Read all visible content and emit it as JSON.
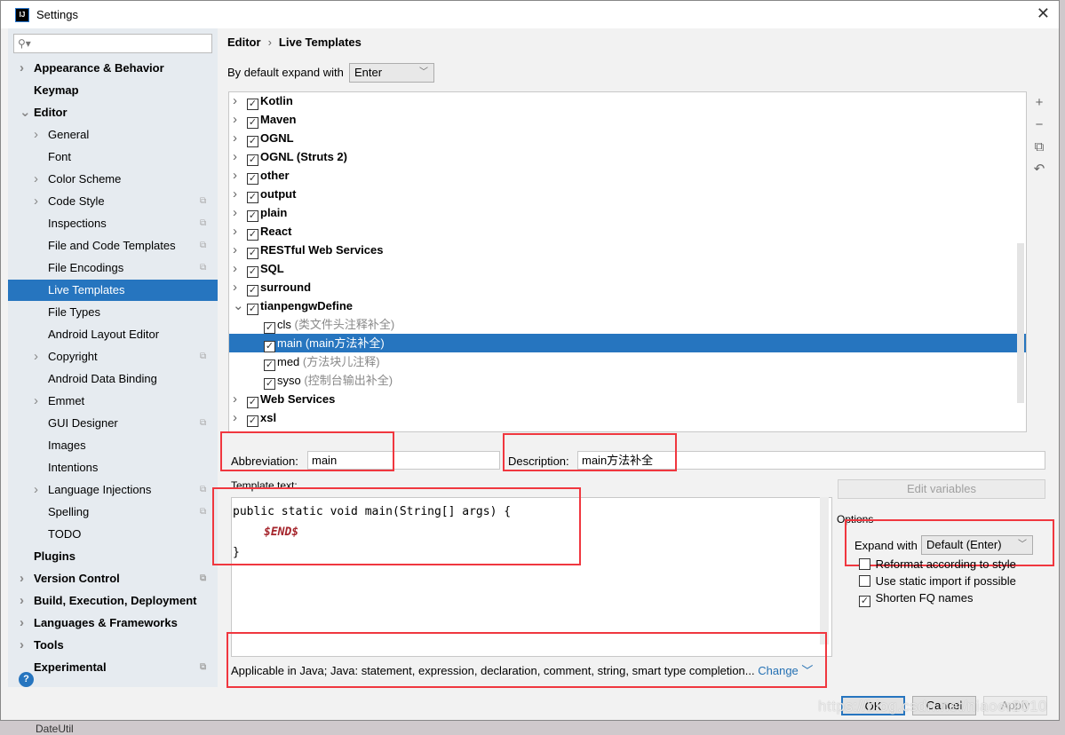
{
  "window": {
    "title": "Settings",
    "close": "✕"
  },
  "sidebar": {
    "search_placeholder": "",
    "items": [
      {
        "label": "Appearance & Behavior",
        "level": 0,
        "bold": true,
        "arrow": "right"
      },
      {
        "label": "Keymap",
        "level": 0,
        "bold": true
      },
      {
        "label": "Editor",
        "level": 0,
        "bold": true,
        "arrow": "down"
      },
      {
        "label": "General",
        "level": 1,
        "arrow": "right"
      },
      {
        "label": "Font",
        "level": 1
      },
      {
        "label": "Color Scheme",
        "level": 1,
        "arrow": "right"
      },
      {
        "label": "Code Style",
        "level": 1,
        "arrow": "right",
        "copy": true
      },
      {
        "label": "Inspections",
        "level": 1,
        "copy": true
      },
      {
        "label": "File and Code Templates",
        "level": 1,
        "copy": true
      },
      {
        "label": "File Encodings",
        "level": 1,
        "copy": true
      },
      {
        "label": "Live Templates",
        "level": 1,
        "selected": true
      },
      {
        "label": "File Types",
        "level": 1
      },
      {
        "label": "Android Layout Editor",
        "level": 1
      },
      {
        "label": "Copyright",
        "level": 1,
        "arrow": "right",
        "copy": true
      },
      {
        "label": "Android Data Binding",
        "level": 1
      },
      {
        "label": "Emmet",
        "level": 1,
        "arrow": "right"
      },
      {
        "label": "GUI Designer",
        "level": 1,
        "copy": true
      },
      {
        "label": "Images",
        "level": 1
      },
      {
        "label": "Intentions",
        "level": 1
      },
      {
        "label": "Language Injections",
        "level": 1,
        "arrow": "right",
        "copy": true
      },
      {
        "label": "Spelling",
        "level": 1,
        "copy": true
      },
      {
        "label": "TODO",
        "level": 1
      },
      {
        "label": "Plugins",
        "level": 0,
        "bold": true
      },
      {
        "label": "Version Control",
        "level": 0,
        "bold": true,
        "arrow": "right",
        "copy": true
      },
      {
        "label": "Build, Execution, Deployment",
        "level": 0,
        "bold": true,
        "arrow": "right"
      },
      {
        "label": "Languages & Frameworks",
        "level": 0,
        "bold": true,
        "arrow": "right"
      },
      {
        "label": "Tools",
        "level": 0,
        "bold": true,
        "arrow": "right"
      },
      {
        "label": "Experimental",
        "level": 0,
        "bold": true,
        "copy": true
      }
    ]
  },
  "breadcrumb": {
    "parent": "Editor",
    "sep": "›",
    "current": "Live Templates"
  },
  "default_expand": {
    "label": "By default expand with",
    "value": "Enter"
  },
  "tree": [
    {
      "name": "Kotlin",
      "group": true
    },
    {
      "name": "Maven",
      "group": true
    },
    {
      "name": "OGNL",
      "group": true
    },
    {
      "name": "OGNL (Struts 2)",
      "group": true
    },
    {
      "name": "other",
      "group": true
    },
    {
      "name": "output",
      "group": true
    },
    {
      "name": "plain",
      "group": true
    },
    {
      "name": "React",
      "group": true
    },
    {
      "name": "RESTful Web Services",
      "group": true
    },
    {
      "name": "SQL",
      "group": true
    },
    {
      "name": "surround",
      "group": true
    },
    {
      "name": "tianpengwDefine",
      "group": true,
      "expanded": true
    },
    {
      "name": "cls",
      "desc": "(类文件头注释补全)"
    },
    {
      "name": "main",
      "desc": "(main方法补全)",
      "selected": true
    },
    {
      "name": "med",
      "desc": "(方法块儿注释)"
    },
    {
      "name": "syso",
      "desc": "(控制台输出补全)"
    },
    {
      "name": "Web Services",
      "group": true
    },
    {
      "name": "xsl",
      "group": true
    }
  ],
  "toolbar": {
    "add": "+",
    "remove": "−",
    "copy": "⧉",
    "restore": "↶"
  },
  "abbreviation": {
    "label": "Abbreviation:",
    "value": "main"
  },
  "description": {
    "label": "Description:",
    "value": "main方法补全"
  },
  "template_text": {
    "label": "Template text:",
    "line1": "public static void main(String[] args) {",
    "line2": "$END$",
    "line3": "}"
  },
  "edit_variables": "Edit variables",
  "options": {
    "title": "Options",
    "expand_with_label": "Expand with",
    "expand_with_value": "Default (Enter)",
    "checkboxes": [
      {
        "label": "Reformat according to style",
        "checked": false
      },
      {
        "label": "Use static import if possible",
        "checked": false
      },
      {
        "label": "Shorten FQ names",
        "checked": true
      }
    ]
  },
  "applicable": {
    "text": "Applicable in Java; Java: statement, expression, declaration, comment, string, smart type completion...",
    "change": "Change"
  },
  "buttons": {
    "ok": "OK",
    "cancel": "Cancel",
    "apply": "Apply",
    "help": "?"
  },
  "watermark": "https://blog.csdn.net/niaoer2010",
  "background_text": "DateUtil",
  "colors": {
    "selection": "#2675bf",
    "highlight_box": "#f0373f",
    "template_var": "#a5252c",
    "link": "#2470b3"
  }
}
